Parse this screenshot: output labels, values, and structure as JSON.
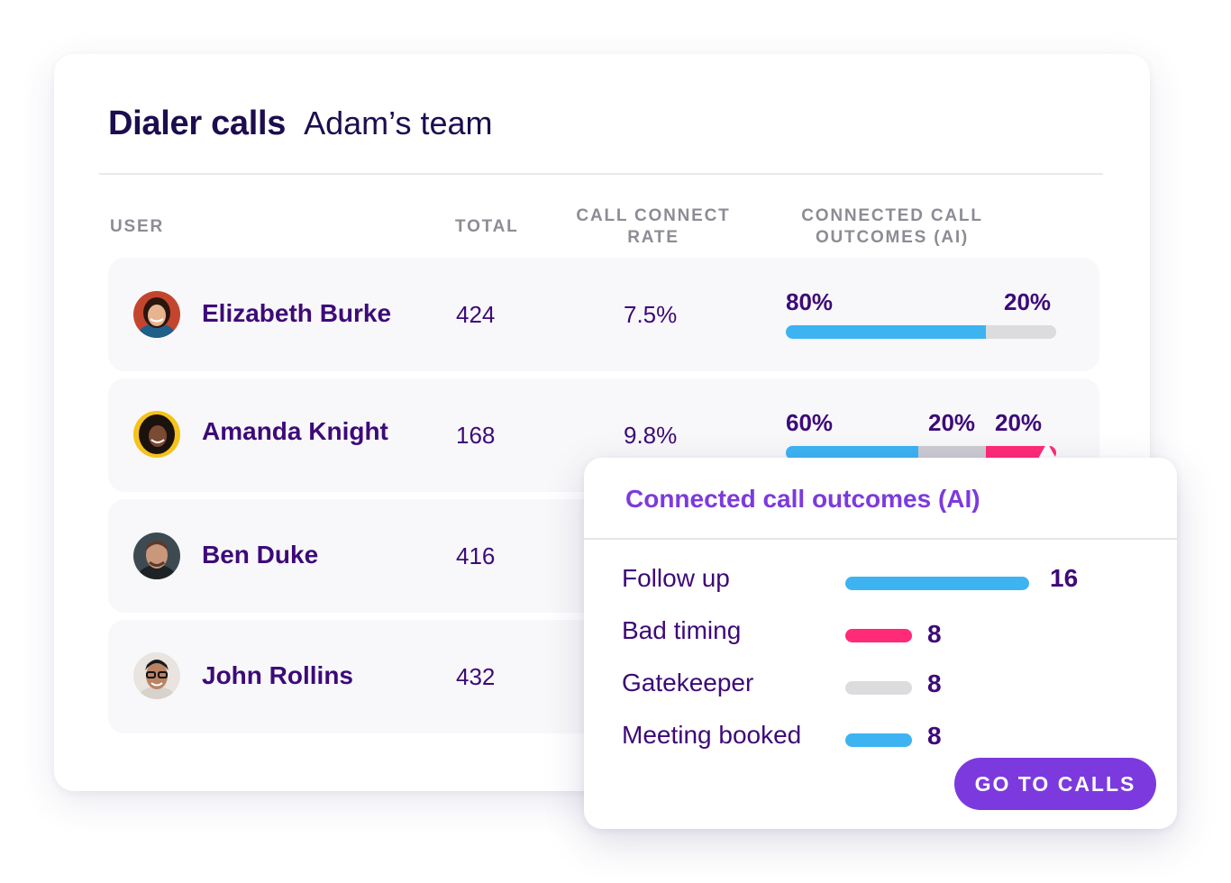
{
  "header": {
    "title": "Dialer calls",
    "subtitle": "Adam’s team"
  },
  "columns": {
    "user": "USER",
    "total": "TOTAL",
    "rate_line1": "CALL CONNECT",
    "rate_line2": "RATE",
    "outcomes_line1": "CONNECTED CALL",
    "outcomes_line2": "OUTCOMES (AI)"
  },
  "rows": [
    {
      "name": "Elizabeth Burke",
      "total": "424",
      "rate": "7.5%",
      "pct_labels": [
        "80%",
        "20%"
      ],
      "segments": [
        0.74,
        0.26
      ]
    },
    {
      "name": "Amanda Knight",
      "total": "168",
      "rate": "9.8%",
      "pct_labels": [
        "60%",
        "20%",
        "20%"
      ],
      "segments": [
        0.49,
        0.25,
        0.26
      ]
    },
    {
      "name": "Ben Duke",
      "total": "416"
    },
    {
      "name": "John Rollins",
      "total": "432"
    }
  ],
  "popup": {
    "title": "Connected call outcomes (AI)",
    "items": [
      {
        "label": "Follow up",
        "value": "16",
        "color": "#3db3f2"
      },
      {
        "label": "Bad timing",
        "value": "8",
        "color": "#ff2a78"
      },
      {
        "label": "Gatekeeper",
        "value": "8",
        "color": "#dcdcdf"
      },
      {
        "label": "Meeting booked",
        "value": "8",
        "color": "#3db3f2"
      }
    ],
    "button_label": "GO TO CALLS"
  },
  "colors": {
    "accent": "#7c3ade",
    "blue": "#3db3f2",
    "pink": "#ff2a78",
    "gray": "#dcdcdf",
    "text": "#3d0a78",
    "title": "#1c0d4f"
  }
}
